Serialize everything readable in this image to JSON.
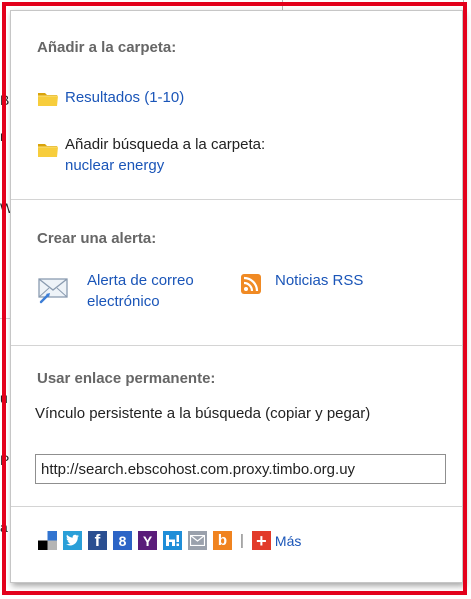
{
  "background": {
    "fragments": [
      "B",
      "r",
      "W",
      "u",
      "P",
      "a"
    ]
  },
  "save_to_folder": {
    "heading": "Añadir a la carpeta:",
    "results_link": "Resultados (1-10)",
    "add_search_label": "Añadir búsqueda a la carpeta:",
    "search_term_link": "nuclear energy"
  },
  "create_alert": {
    "heading": "Crear una alerta:",
    "email_alert_line1": "Alerta de correo",
    "email_alert_line2": "electrónico",
    "rss_link": "Noticias RSS"
  },
  "permalink": {
    "heading": "Usar enlace permanente:",
    "description": "Vínculo persistente a la búsqueda (copiar y pegar)",
    "url_value": "http://search.ebscohost.com.proxy.timbo.org.uy"
  },
  "share": {
    "separator": "|",
    "more_label": "Más",
    "icons": [
      "delicious-icon",
      "twitter-icon",
      "facebook-icon",
      "google-plus-icon",
      "yahoo-icon",
      "hatena-icon",
      "email-icon",
      "blogger-icon"
    ]
  },
  "colors": {
    "highlight": "#e3001b",
    "link": "#1a55b8",
    "heading": "#666666",
    "twitter": "#2a9fd8",
    "facebook": "#2b4f91",
    "google_plus": "#2c64c6",
    "yahoo": "#5a1c7a",
    "hatena": "#1f8ed8",
    "blogger": "#f0831f",
    "more_plus": "#e23b2a"
  }
}
